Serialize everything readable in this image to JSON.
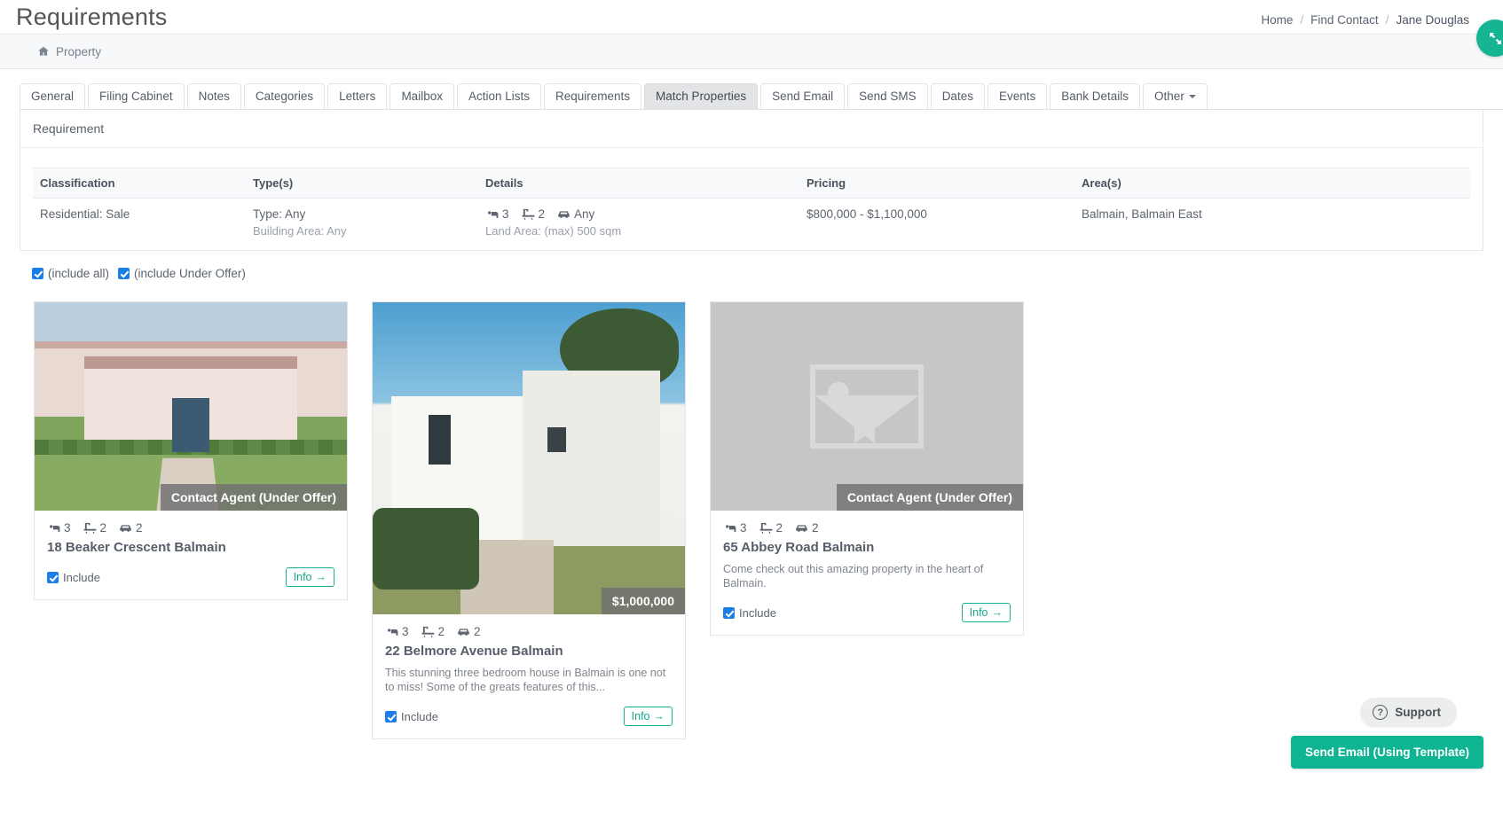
{
  "header": {
    "title": "Requirements",
    "breadcrumb": [
      "Home",
      "Find Contact",
      "Jane Douglas"
    ],
    "separator": "/",
    "expand_icon": "expand-arrows-icon"
  },
  "subheader": {
    "icon": "home-icon",
    "label": "Property"
  },
  "tabs": [
    {
      "label": "General",
      "active": false
    },
    {
      "label": "Filing Cabinet",
      "active": false
    },
    {
      "label": "Notes",
      "active": false
    },
    {
      "label": "Categories",
      "active": false
    },
    {
      "label": "Letters",
      "active": false
    },
    {
      "label": "Mailbox",
      "active": false
    },
    {
      "label": "Action Lists",
      "active": false
    },
    {
      "label": "Requirements",
      "active": false
    },
    {
      "label": "Match Properties",
      "active": true
    },
    {
      "label": "Send Email",
      "active": false
    },
    {
      "label": "Send SMS",
      "active": false
    },
    {
      "label": "Dates",
      "active": false
    },
    {
      "label": "Events",
      "active": false
    },
    {
      "label": "Bank Details",
      "active": false
    },
    {
      "label": "Other",
      "active": false,
      "has_caret": true
    }
  ],
  "panel": {
    "heading": "Requirement"
  },
  "requirement_table": {
    "columns": [
      "Classification",
      "Type(s)",
      "Details",
      "Pricing",
      "Area(s)"
    ],
    "row": {
      "classification": "Residential: Sale",
      "type": "Type: Any",
      "building_area": "Building Area: Any",
      "beds": "3",
      "baths": "2",
      "cars": "Any",
      "land_area": "Land Area: (max) 500 sqm",
      "pricing": "$800,000 - $1,100,000",
      "areas": "Balmain, Balmain East"
    }
  },
  "include_filters": [
    {
      "label": "(include all)",
      "checked": true
    },
    {
      "label": "(include Under Offer)",
      "checked": true
    }
  ],
  "cards": [
    {
      "title": "18 Beaker Crescent Balmain",
      "beds": "3",
      "baths": "2",
      "cars": "2",
      "badge": "Contact Agent (Under Offer)",
      "description": "",
      "include_label": "Include",
      "include_checked": true,
      "info_label": "Info",
      "info_arrow": "→"
    },
    {
      "title": "22 Belmore Avenue Balmain",
      "beds": "3",
      "baths": "2",
      "cars": "2",
      "badge": "$1,000,000",
      "description": "This stunning three bedroom house in Balmain is one not to miss! Some of the greats features of this...",
      "include_label": "Include",
      "include_checked": true,
      "info_label": "Info",
      "info_arrow": "→"
    },
    {
      "title": "65 Abbey Road Balmain",
      "beds": "3",
      "baths": "2",
      "cars": "2",
      "badge": "Contact Agent (Under Offer)",
      "description": "Come check out this amazing property in the heart of Balmain.",
      "include_label": "Include",
      "include_checked": true,
      "info_label": "Info",
      "info_arrow": "→"
    }
  ],
  "support": {
    "label": "Support",
    "icon": "question-circle-icon"
  },
  "send_email": {
    "label": "Send Email (Using Template)"
  },
  "colors": {
    "accent_green": "#0fb492",
    "checkbox_blue": "#1c7fe8",
    "badge_grey": "#707070",
    "active_tab": "#e3e4e6"
  }
}
